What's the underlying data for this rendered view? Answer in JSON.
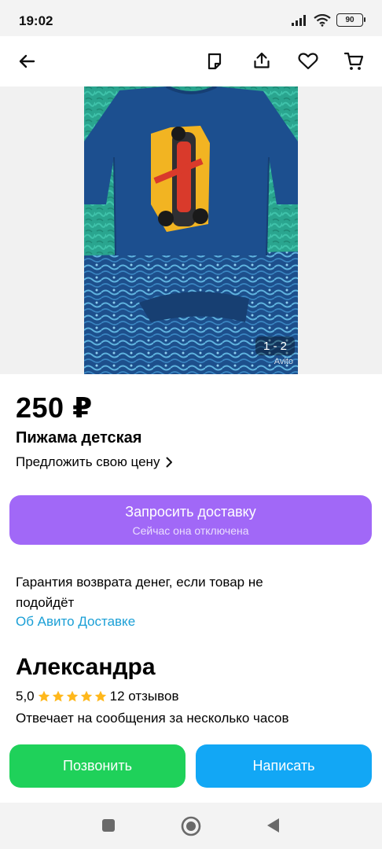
{
  "status_bar": {
    "time": "19:02",
    "battery": "90"
  },
  "top_bar": {
    "icons": [
      "back-arrow-icon",
      "note-icon",
      "share-icon",
      "heart-icon",
      "cart-icon"
    ]
  },
  "gallery": {
    "counter": "1 - 2",
    "watermark": "Avito"
  },
  "listing": {
    "price": "250 ₽",
    "title": "Пижама детская",
    "offer_price": "Предложить свою цену"
  },
  "delivery": {
    "button_label": "Запросить доставку",
    "button_sublabel": "Сейчас она отключена",
    "guarantee_text": "Гарантия возврата денег, если товар не подойдёт",
    "link": "Об Авито Доставке"
  },
  "seller": {
    "name": "Александра",
    "rating": "5,0",
    "star_count": 5,
    "reviews": "12 отзывов",
    "response_time": "Отвечает на сообщения за несколько часов"
  },
  "actions": {
    "call": "Позвонить",
    "write": "Написать"
  },
  "colors": {
    "delivery_button": "#a168f7",
    "call_button": "#1fd15a",
    "write_button": "#12a7f5",
    "link": "#1a9fd6",
    "star": "#ffb81c"
  }
}
